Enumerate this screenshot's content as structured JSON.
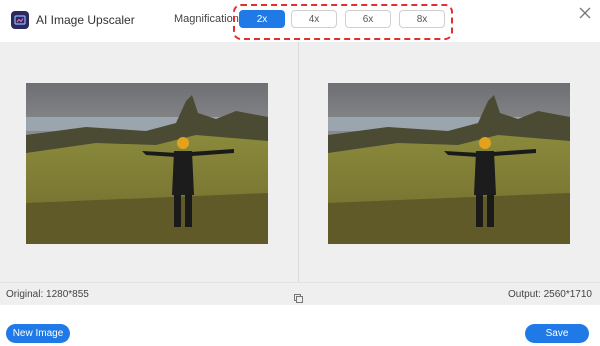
{
  "app": {
    "title": "AI Image Upscaler",
    "icon": "image-upscale-icon"
  },
  "magnification": {
    "label": "Magnification:",
    "options": [
      "2x",
      "4x",
      "6x",
      "8x"
    ],
    "selected": "2x"
  },
  "preview": {
    "original_label": "Original: 1280*855",
    "output_label": "Output: 2560*1710"
  },
  "buttons": {
    "new_image": "New Image",
    "save": "Save"
  },
  "colors": {
    "accent": "#1f7ae8",
    "highlight_border": "#e03030",
    "icon_bg": "#2c2a5c"
  }
}
